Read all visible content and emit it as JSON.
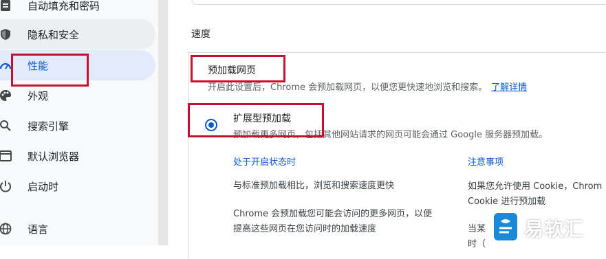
{
  "sidebar": {
    "items": [
      {
        "label": "自动填充和密码",
        "icon": "clipboard-icon"
      },
      {
        "label": "隐私和安全",
        "icon": "shield-icon"
      },
      {
        "label": "性能",
        "icon": "speedometer-icon"
      },
      {
        "label": "外观",
        "icon": "palette-icon"
      },
      {
        "label": "搜索引擎",
        "icon": "search-icon"
      },
      {
        "label": "默认浏览器",
        "icon": "browser-icon"
      },
      {
        "label": "启动时",
        "icon": "power-icon"
      },
      {
        "label": "语言",
        "icon": "globe-icon"
      }
    ]
  },
  "main": {
    "section_title": "速度",
    "preload": {
      "title": "预加载网页",
      "description": "开启此设置后，Chrome 会预加载网页，以便您更快速地浏览和搜索。",
      "learn_more": "了解详情"
    },
    "extended": {
      "title": "扩展型预加载",
      "description": "预加载更多网页，包括其他网站请求的网页可能会通过 Google 服务器预加载。",
      "left_heading": "处于开启状态时",
      "left_p1": "与标准预加载相比，浏览和搜索速度更快",
      "left_p2_line1": "Chrome 会预加载您可能会访问的更多网页，以便",
      "left_p2_line2": "提高这些网页在您访问时的加载速度",
      "right_heading": "注意事项",
      "right_p1_line1": "如果您允许使用 Cookie，Chrom",
      "right_p1_line2": "Cookie 进行预加载",
      "right_p2_line1": "当某",
      "right_p2_line2": "时（"
    }
  },
  "watermark": {
    "text": "易软汇",
    "color": "#1a8ad8"
  },
  "colors": {
    "accent": "#0b57d0",
    "highlight_box": "#c8102e",
    "active_bg": "#e3ebfb"
  }
}
